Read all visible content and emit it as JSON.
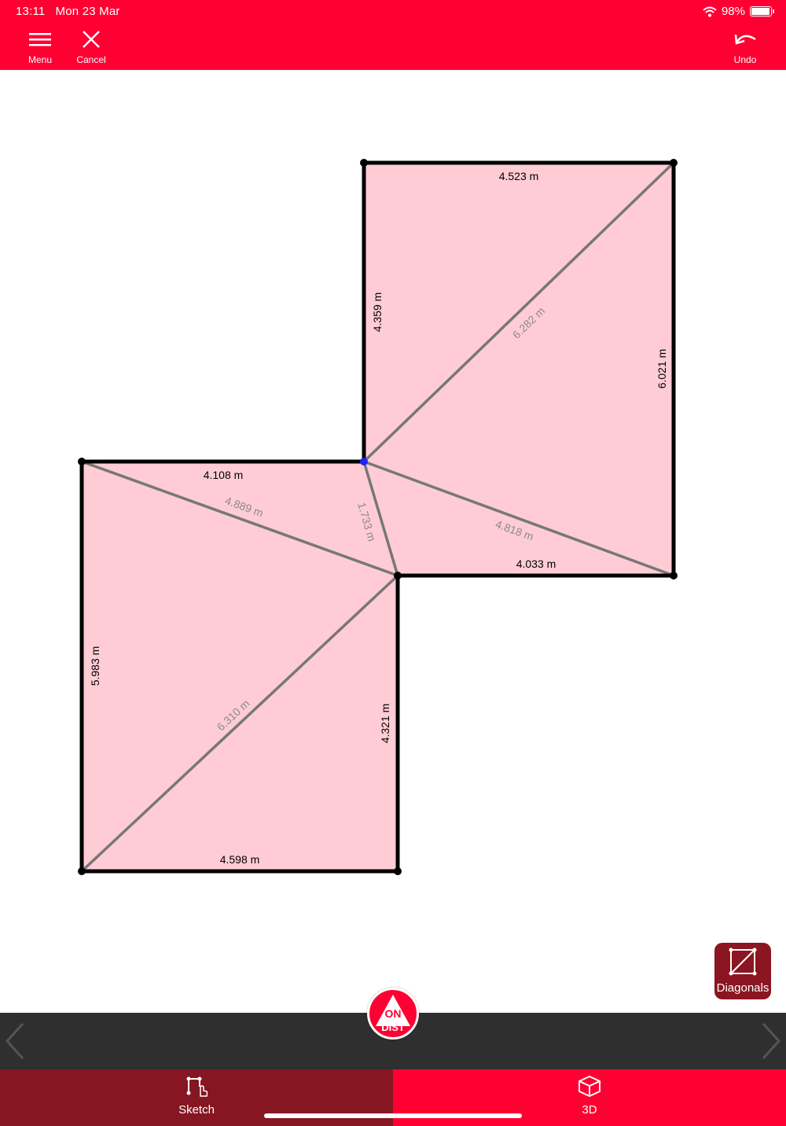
{
  "status_bar": {
    "time": "13:11",
    "date": "Mon 23 Mar",
    "battery": "98%"
  },
  "toolbar": {
    "menu_label": "Menu",
    "cancel_label": "Cancel",
    "undo_label": "Undo"
  },
  "sketch": {
    "fill_color": "#ffccd5",
    "wall_color": "#000000",
    "diagonal_color": "#777777",
    "walls": {
      "top_room_top": "4.523 m",
      "top_room_left": "4.359 m",
      "top_room_right": "6.021 m",
      "top_room_bottom": "4.033 m",
      "bottom_room_top": "4.108 m",
      "bottom_room_left": "5.983 m",
      "bottom_room_right": "4.321 m",
      "bottom_room_bottom": "4.598 m"
    },
    "diagonals": {
      "top_room": "6.282 m",
      "connector": "1.733 m",
      "upper_left": "4.889 m",
      "lower_right": "4.818 m",
      "bottom_room": "6.310 m"
    }
  },
  "diagonals_button": {
    "label": "Diagonals"
  },
  "measure_button": {
    "line1": "ON",
    "line2": "DIST"
  },
  "tabs": {
    "sketch_label": "Sketch",
    "threed_label": "3D"
  },
  "colors": {
    "brand_red": "#ff0033",
    "dark_red": "#861622",
    "toolbar_dark": "#2f2f2f"
  }
}
